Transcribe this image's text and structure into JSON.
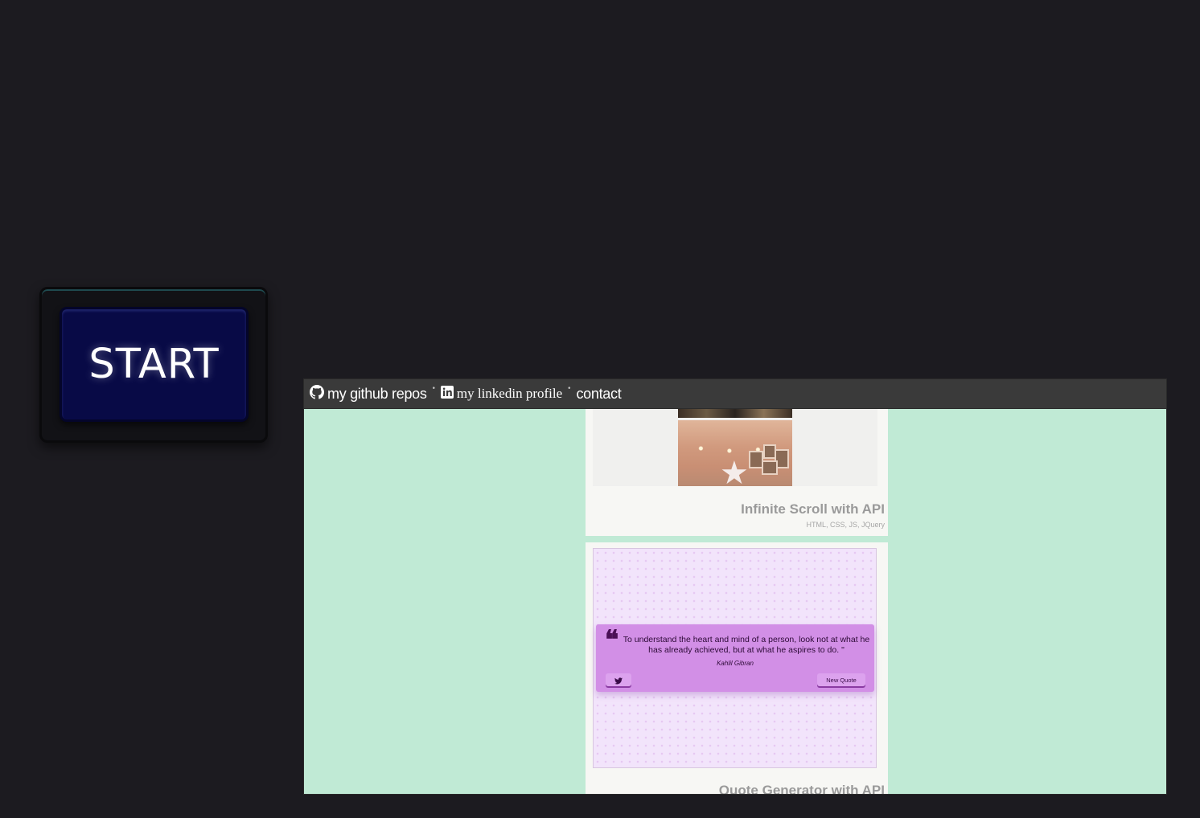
{
  "start_button": {
    "label": "START"
  },
  "nav": {
    "github_label": "my github repos",
    "linkedin_label": "my linkedin profile",
    "contact_label": "contact",
    "separator": "•"
  },
  "projects": [
    {
      "title": "Infinite Scroll with API",
      "tech": "HTML, CSS, JS, JQuery"
    },
    {
      "title": "Quote Generator with API"
    }
  ],
  "quote_preview": {
    "mark": "❝",
    "text": "To understand the heart and mind of a person, look not at what he has already achieved, but at what he aspires to do. \"",
    "author": "Kahlil Gibran",
    "new_quote_label": "New Quote"
  },
  "colors": {
    "page_bg": "#1c1b20",
    "start_button": "#080a46",
    "site_bg": "#c0ead5",
    "navbar": "#3a3a3a",
    "quote_box": "#d28fe6"
  }
}
